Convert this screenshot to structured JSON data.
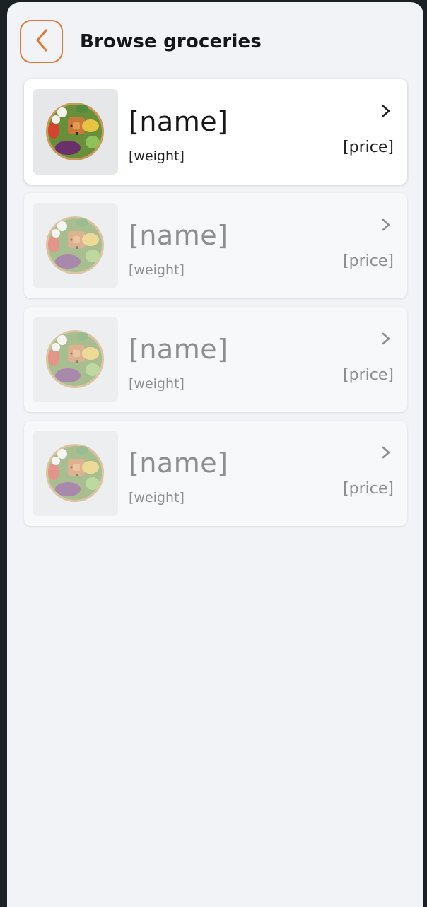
{
  "header": {
    "title": "Browse groceries",
    "back_icon": "chevron-left-icon",
    "accent_color": "#e07a37"
  },
  "items": [
    {
      "name": "[name]",
      "weight": "[weight]",
      "price": "[price]",
      "image": "salad-bowl",
      "state": "active"
    },
    {
      "name": "[name]",
      "weight": "[weight]",
      "price": "[price]",
      "image": "salad-bowl",
      "state": "dimmed"
    },
    {
      "name": "[name]",
      "weight": "[weight]",
      "price": "[price]",
      "image": "salad-bowl",
      "state": "dimmed"
    },
    {
      "name": "[name]",
      "weight": "[weight]",
      "price": "[price]",
      "image": "salad-bowl",
      "state": "dimmed"
    }
  ]
}
